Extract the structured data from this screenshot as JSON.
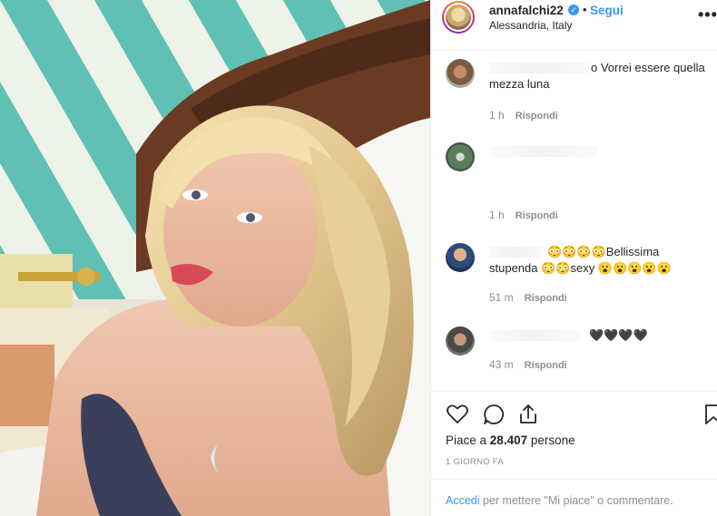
{
  "post": {
    "username": "annafalchi22",
    "follow_label": "Segui",
    "separator": "•",
    "location": "Alessandria, Italy",
    "more_label": "•••",
    "verified_glyph": "✓",
    "icons": [
      "heart-icon",
      "comment-icon",
      "share-icon",
      "bookmark-icon"
    ]
  },
  "comments": [
    {
      "text": "o Vorrei essere quella mezza luna",
      "time": "1 h",
      "reply": "Rispondi"
    },
    {
      "text": "",
      "time": "1 h",
      "reply": "Rispondi"
    },
    {
      "text": "😳😳😳😳Bellissima stupenda 😳😳sexy 😮😮😮😮😮",
      "time": "51 m",
      "reply": "Rispondi"
    },
    {
      "text": "🖤🖤🖤🖤",
      "time": "43 m",
      "reply": "Rispondi"
    }
  ],
  "likes": {
    "prefix": "Piace a",
    "count": "28.407",
    "suffix": "persone"
  },
  "timestamp": "1 GIORNO FA",
  "login": {
    "link": "Accedi",
    "rest": "per mettere \"Mi piace\" o commentare."
  },
  "colors": {
    "accent": "#3897f0",
    "text": "#262626",
    "muted": "#8e8e8e",
    "divider": "#efefef"
  }
}
